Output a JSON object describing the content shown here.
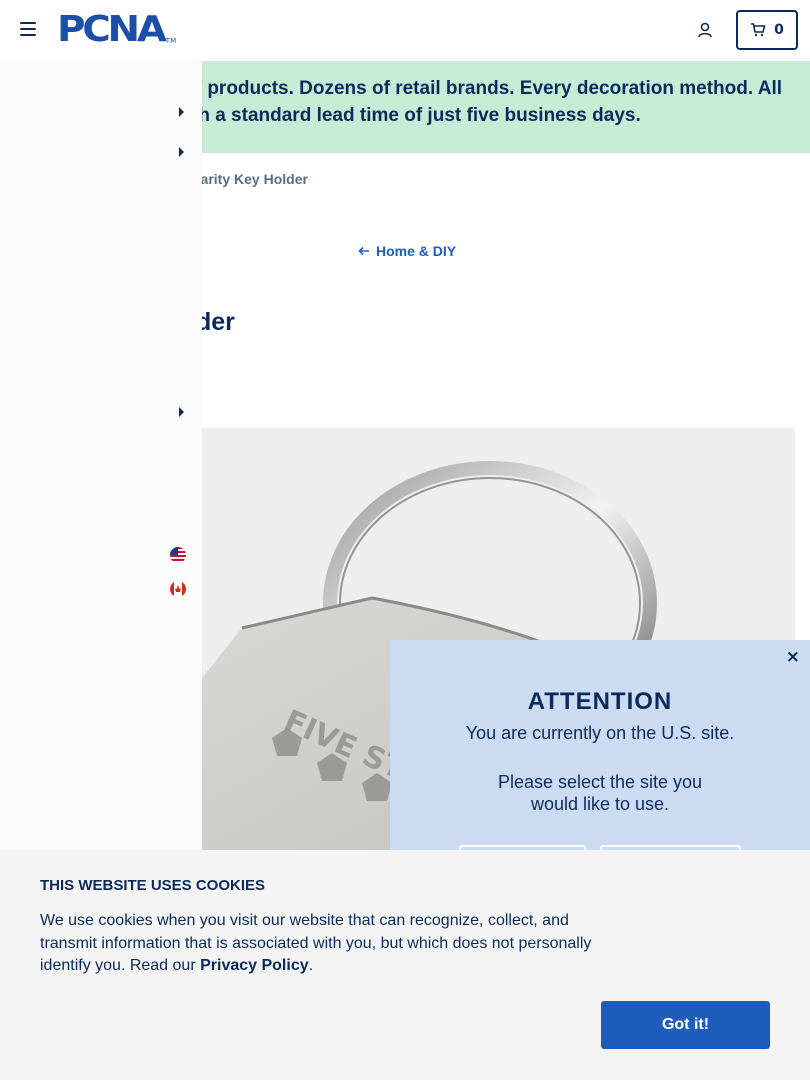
{
  "header": {
    "logo_text": "PCNA",
    "logo_tm": "TM",
    "cart_count": "0"
  },
  "banner": {
    "line1": "s of products. Dozens of retail brands. Every decoration method. All",
    "line2": "th a standard lead time of just five business days."
  },
  "breadcrumb": {
    "current": "harity Key Holder"
  },
  "back_link": {
    "label": "Home & DIY"
  },
  "product": {
    "title_partial": "der",
    "engraving": "FIVE STA"
  },
  "side_nav": {
    "flags": [
      "us-flag-icon",
      "canada-flag-icon"
    ]
  },
  "attention": {
    "title": "ATTENTION",
    "line1": "You are currently on the U.S. site.",
    "line2": "Please select the site you",
    "line3": "would like to use.",
    "close": "×"
  },
  "cookie": {
    "title": "THIS WEBSITE USES COOKIES",
    "body": "We use cookies when you visit our website that can recognize, collect, and transmit information that is associated with you, but which does not personally identify you. Read our ",
    "link": "Privacy Policy",
    "period": ".",
    "button": "Got it!"
  },
  "colors": {
    "navy": "#0b2a5b",
    "brand_blue": "#1f5dbd",
    "banner_green": "#c7ecd5",
    "attention_bg": "#cbdcf2"
  }
}
